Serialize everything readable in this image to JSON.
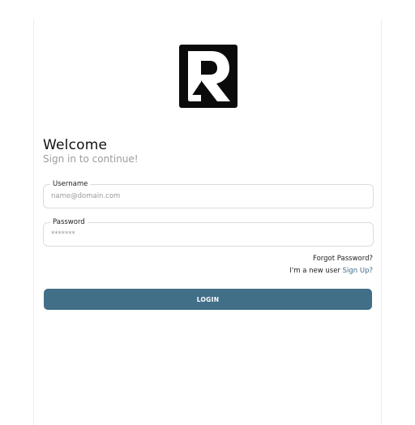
{
  "logo": {
    "icon": "r-letter-logo-icon",
    "background": "#0b0b0b",
    "foreground": "#ffffff"
  },
  "header": {
    "title": "Welcome",
    "subtitle": "Sign in to continue!"
  },
  "form": {
    "username": {
      "label": "Username",
      "placeholder": "name@domain.com",
      "value": ""
    },
    "password": {
      "label": "Password",
      "placeholder": "*******",
      "value": ""
    }
  },
  "links": {
    "forgot_password": "Forgot Password?",
    "new_user_prefix": "I'm a new user",
    "sign_up": "Sign Up?"
  },
  "actions": {
    "login_label": "LOGIN"
  },
  "colors": {
    "accent": "#426f88",
    "link": "#3f6b86",
    "subtitle": "#9c9c9c"
  }
}
